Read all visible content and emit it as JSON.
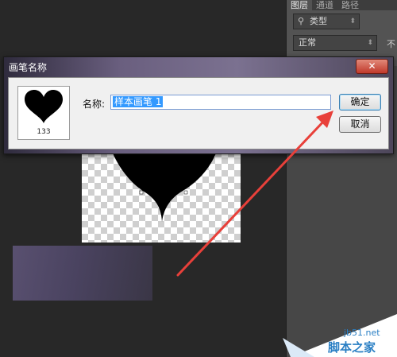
{
  "panel": {
    "tabs": [
      "图层",
      "通道",
      "路径"
    ],
    "filter_kind": "类型",
    "blend_mode": "正常",
    "ext_label": "不"
  },
  "dialog": {
    "title": "画笔名称",
    "close_glyph": "✕",
    "brush_size": "133",
    "name_label": "名称:",
    "name_value": "样本画笔 1",
    "ok_label": "确定",
    "cancel_label": "取消"
  },
  "watermark": {
    "site": "jb51.net",
    "brand": "脚本之家"
  },
  "colors": {
    "app_bg": "#282828",
    "panel_bg": "#535353",
    "selection_highlight": "#3399ff",
    "arrow": "#e8403a",
    "watermark_text": "#2a7fc4"
  },
  "icons": [
    "search-icon",
    "chevron-icon",
    "close-icon",
    "heart-brush-icon"
  ]
}
